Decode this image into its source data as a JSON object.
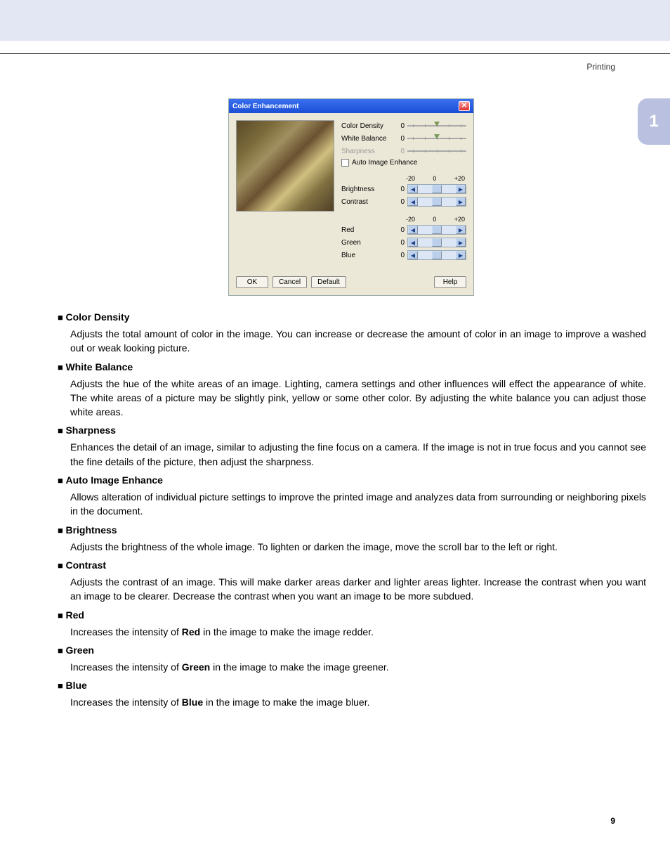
{
  "header": {
    "crumb": "Printing"
  },
  "chapter_tab": "1",
  "page_number": "9",
  "dialog": {
    "title": "Color Enhancement",
    "sliders": [
      {
        "label": "Color Density",
        "value": "0",
        "disabled": false
      },
      {
        "label": "White Balance",
        "value": "0",
        "disabled": false
      },
      {
        "label": "Sharpness",
        "value": "0",
        "disabled": true
      }
    ],
    "checkbox_label": "Auto Image Enhance",
    "scale_left": "-20",
    "scale_mid": "0",
    "scale_right": "+20",
    "scrollers1": [
      {
        "label": "Brightness",
        "value": "0"
      },
      {
        "label": "Contrast",
        "value": "0"
      }
    ],
    "scrollers2": [
      {
        "label": "Red",
        "value": "0"
      },
      {
        "label": "Green",
        "value": "0"
      },
      {
        "label": "Blue",
        "value": "0"
      }
    ],
    "btn_ok": "OK",
    "btn_cancel": "Cancel",
    "btn_default": "Default",
    "btn_help": "Help"
  },
  "items": [
    {
      "name": "Color Density",
      "desc_pre": "Adjusts the total amount of color in the image. You can increase or decrease the amount of color in an image to improve a washed out or weak looking picture.",
      "bold": "",
      "desc_post": ""
    },
    {
      "name": "White Balance",
      "desc_pre": "Adjusts the hue of the white areas of an image. Lighting, camera settings and other influences will effect the appearance of white. The white areas of a picture may be slightly pink, yellow or some other color. By adjusting the white balance you can adjust those white areas.",
      "bold": "",
      "desc_post": ""
    },
    {
      "name": "Sharpness",
      "desc_pre": "Enhances the detail of an image, similar to adjusting the fine focus on a camera. If the image is not in true focus and you cannot see the fine details of the picture, then adjust the sharpness.",
      "bold": "",
      "desc_post": ""
    },
    {
      "name": "Auto Image Enhance",
      "desc_pre": "Allows alteration of individual picture settings to improve the printed image and analyzes data from surrounding or neighboring pixels in the document.",
      "bold": "",
      "desc_post": ""
    },
    {
      "name": "Brightness",
      "desc_pre": "Adjusts the brightness of the whole image. To lighten or darken the image, move the scroll bar to the left or right.",
      "bold": "",
      "desc_post": ""
    },
    {
      "name": "Contrast",
      "desc_pre": "Adjusts the contrast of an image. This will make darker areas darker and lighter areas lighter. Increase the contrast when you want an image to be clearer. Decrease the contrast when you want an image to be more subdued.",
      "bold": "",
      "desc_post": ""
    },
    {
      "name": "Red",
      "desc_pre": "Increases the intensity of ",
      "bold": "Red",
      "desc_post": " in the image to make the image redder."
    },
    {
      "name": "Green",
      "desc_pre": "Increases the intensity of ",
      "bold": "Green",
      "desc_post": " in the image to make the image greener."
    },
    {
      "name": "Blue",
      "desc_pre": "Increases the intensity of ",
      "bold": "Blue",
      "desc_post": " in the image to make the image bluer."
    }
  ]
}
